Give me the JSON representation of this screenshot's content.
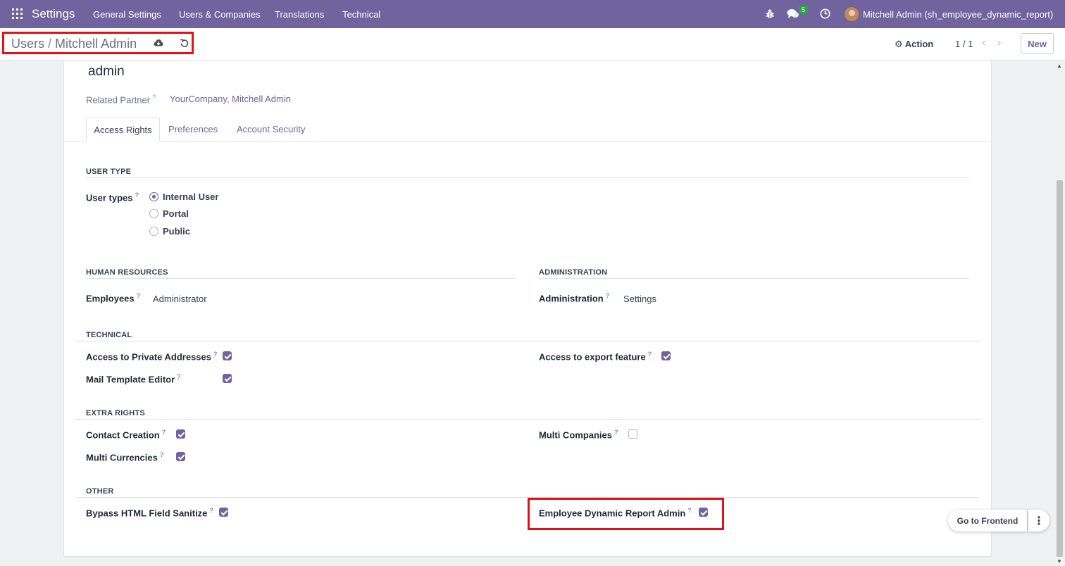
{
  "topbar": {
    "app_title": "Settings",
    "menu": [
      "General Settings",
      "Users & Companies",
      "Translations",
      "Technical"
    ],
    "chat_count": "5",
    "user_name": "Mitchell Admin (sh_employee_dynamic_report)",
    "icons": [
      "apps-grid-icon",
      "bug-icon",
      "chat-icon",
      "clock-icon"
    ],
    "color": "#71639e"
  },
  "control_panel": {
    "breadcrumb_parent": "Users",
    "breadcrumb_separator": "/",
    "breadcrumb_current": "Mitchell Admin",
    "action_label": "Action",
    "pager": "1 / 1",
    "new_label": "New"
  },
  "form": {
    "login": "admin",
    "related_partner_label": "Related Partner",
    "related_partner_value": "YourCompany, Mitchell Admin",
    "help_mark": "?",
    "tabs": [
      "Access Rights",
      "Preferences",
      "Account Security"
    ],
    "active_tab": "Access Rights",
    "user_type": {
      "section": "USER TYPE",
      "label": "User types",
      "options": [
        "Internal User",
        "Portal",
        "Public"
      ],
      "selected": "Internal User"
    },
    "human_resources": {
      "section": "HUMAN RESOURCES",
      "label": "Employees",
      "value": "Administrator"
    },
    "administration": {
      "section": "ADMINISTRATION",
      "label": "Administration",
      "value": "Settings"
    },
    "technical": {
      "section": "TECHNICAL",
      "private_addresses": "Access to Private Addresses",
      "mail_template_editor": "Mail Template Editor",
      "export_feature": "Access to export feature"
    },
    "extra_rights": {
      "section": "EXTRA RIGHTS",
      "contact_creation": "Contact Creation",
      "multi_currencies": "Multi Currencies",
      "multi_companies": "Multi Companies"
    },
    "other": {
      "section": "OTHER",
      "bypass_html": "Bypass HTML Field Sanitize",
      "employee_dynamic_report_admin": "Employee Dynamic Report Admin"
    }
  },
  "checkbox_states": {
    "private_addresses": true,
    "mail_template_editor": true,
    "export_feature": true,
    "contact_creation": true,
    "multi_currencies": true,
    "multi_companies": false,
    "bypass_html": true,
    "employee_dynamic_report_admin": true
  },
  "floating": {
    "go_to_frontend": "Go to Frontend",
    "more": "⋮"
  },
  "highlight_color": "#e3101a"
}
